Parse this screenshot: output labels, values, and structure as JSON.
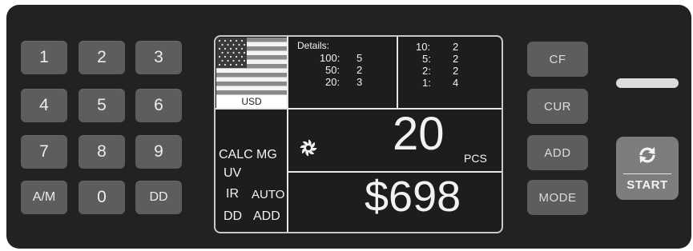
{
  "keypad": {
    "keys": [
      "1",
      "2",
      "3",
      "4",
      "5",
      "6",
      "7",
      "8",
      "9",
      "A/M",
      "0",
      "DD"
    ]
  },
  "right_buttons": {
    "cf": "CF",
    "cur": "CUR",
    "add": "ADD",
    "mode": "MODE"
  },
  "start_button": {
    "label": "START"
  },
  "display": {
    "currency": "USD",
    "details_title": "Details:",
    "details_left": [
      {
        "denom": "100:",
        "count": "5"
      },
      {
        "denom": "50:",
        "count": "2"
      },
      {
        "denom": "20:",
        "count": "3"
      }
    ],
    "details_right": [
      {
        "denom": "10:",
        "count": "2"
      },
      {
        "denom": "5:",
        "count": "2"
      },
      {
        "denom": "2:",
        "count": "2"
      },
      {
        "denom": "1:",
        "count": "4"
      }
    ],
    "modes": {
      "calc": "CALC",
      "mg": "MG",
      "uv": "UV",
      "ir": "IR",
      "auto": "AUTO",
      "dd": "DD",
      "add": "ADD"
    },
    "pieces": "20",
    "pieces_unit": "PCS",
    "amount": "$698"
  },
  "colors": {
    "panel": "#222222",
    "key": "#5d5d5d",
    "start": "#7d7d7d",
    "screen": "#1d1d1d"
  },
  "icons": [
    "fan-icon",
    "refresh-icon",
    "us-flag"
  ]
}
